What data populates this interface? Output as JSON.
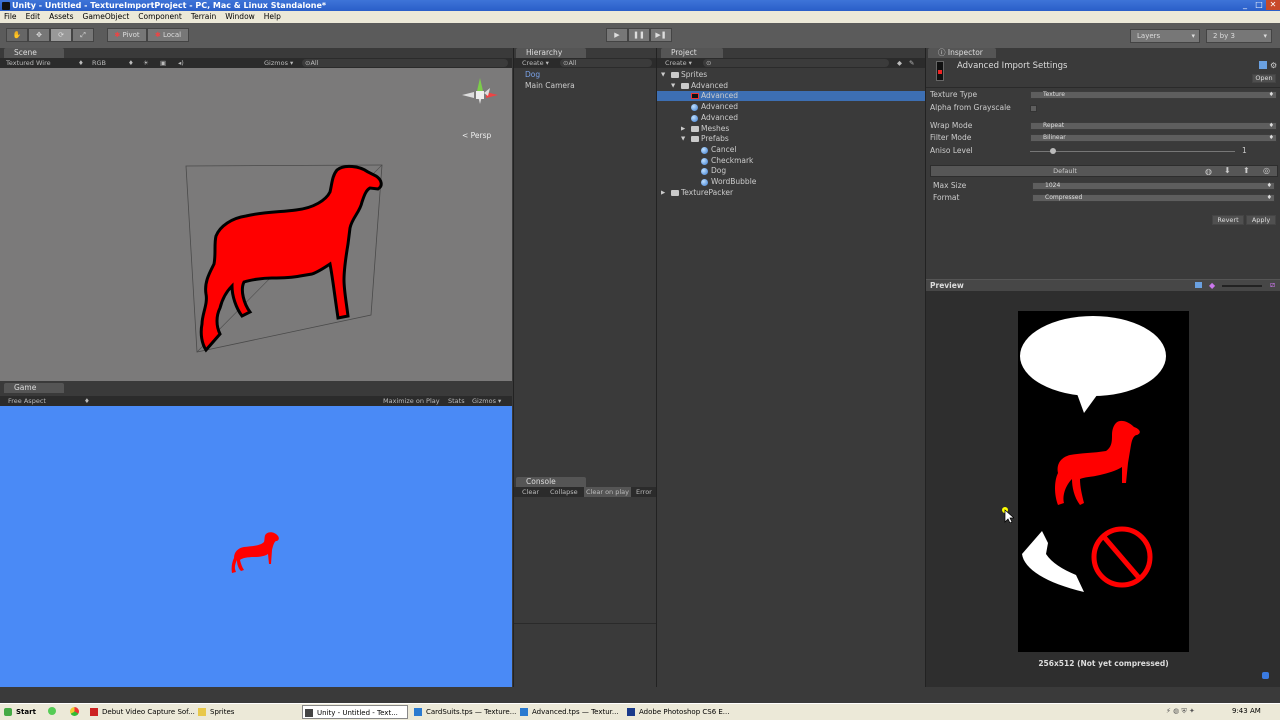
{
  "window": {
    "title": "Unity - Untitled - TextureImportProject - PC, Mac & Linux Standalone*"
  },
  "menu": [
    "File",
    "Edit",
    "Assets",
    "GameObject",
    "Component",
    "Terrain",
    "Window",
    "Help"
  ],
  "toolbar": {
    "pivot": "Pivot",
    "local": "Local",
    "layers": "Layers",
    "layout": "2 by 3"
  },
  "scene": {
    "tab": "Scene",
    "shading": "Textured Wire",
    "rgb": "RGB",
    "gizmos": "Gizmos",
    "search": "All",
    "persp": "Persp"
  },
  "game": {
    "tab": "Game",
    "aspect": "Free Aspect",
    "maximize": "Maximize on Play",
    "stats": "Stats",
    "gizmos": "Gizmos"
  },
  "hierarchy": {
    "tab": "Hierarchy",
    "create": "Create",
    "search": "All",
    "items": [
      "Dog",
      "Main Camera"
    ]
  },
  "console": {
    "tab": "Console",
    "clear": "Clear",
    "collapse": "Collapse",
    "clear_on_play": "Clear on play",
    "error": "Error"
  },
  "project": {
    "tab": "Project",
    "create": "Create",
    "tree": [
      {
        "label": "Sprites",
        "indent": 0,
        "type": "folder-open"
      },
      {
        "label": "Advanced",
        "indent": 1,
        "type": "folder-open"
      },
      {
        "label": "Advanced",
        "indent": 2,
        "type": "texture",
        "selected": true
      },
      {
        "label": "Advanced",
        "indent": 2,
        "type": "sphere"
      },
      {
        "label": "Advanced",
        "indent": 2,
        "type": "sphere"
      },
      {
        "label": "Meshes",
        "indent": 2,
        "type": "folder-closed"
      },
      {
        "label": "Prefabs",
        "indent": 2,
        "type": "folder-open"
      },
      {
        "label": "Cancel",
        "indent": 3,
        "type": "sphere"
      },
      {
        "label": "Checkmark",
        "indent": 3,
        "type": "sphere"
      },
      {
        "label": "Dog",
        "indent": 3,
        "type": "sphere"
      },
      {
        "label": "WordBubble",
        "indent": 3,
        "type": "sphere"
      },
      {
        "label": "TexturePacker",
        "indent": 0,
        "type": "folder-closed"
      }
    ]
  },
  "inspector": {
    "tab": "Inspector",
    "title": "Advanced Import Settings",
    "open": "Open",
    "fields": [
      {
        "label": "Texture Type",
        "value": "Texture"
      },
      {
        "label": "Alpha from Grayscale",
        "value": ""
      },
      {
        "label": "Wrap Mode",
        "value": "Repeat"
      },
      {
        "label": "Filter Mode",
        "value": "Bilinear"
      },
      {
        "label": "Aniso Level",
        "value": "1"
      }
    ],
    "aniso_level": 1,
    "platform_default": "Default",
    "max_size_label": "Max Size",
    "max_size": "1024",
    "format_label": "Format",
    "format": "Compressed",
    "revert": "Revert",
    "apply": "Apply"
  },
  "preview": {
    "title": "Preview",
    "info": "256x512 (Not yet compressed)"
  },
  "taskbar": {
    "start": "Start",
    "time": "9:43 AM",
    "tasks": [
      {
        "label": "Debut Video Capture Sof...",
        "color": "#c22"
      },
      {
        "label": "Sprites",
        "color": "#e8c84a"
      },
      {
        "label": "Unity - Untitled - Text...",
        "color": "#444"
      },
      {
        "label": "CardSuits.tps — Texture...",
        "color": "#2a7ad0"
      },
      {
        "label": "Advanced.tps — Textur...",
        "color": "#2a7ad0"
      },
      {
        "label": "Adobe Photoshop CS6 E...",
        "color": "#1a3a8a"
      }
    ]
  },
  "colors": {
    "dog": "#ff0000",
    "game_bg": "#4a8af6",
    "selection": "#3d6fb3",
    "panel": "#3a3a3a"
  }
}
